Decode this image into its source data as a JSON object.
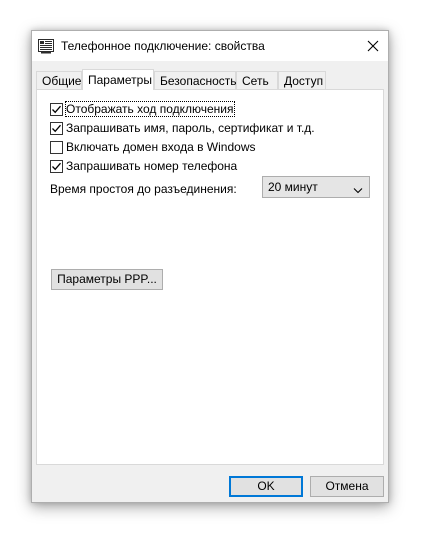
{
  "window": {
    "title": "Телефонное подключение: свойства"
  },
  "tabs": [
    {
      "label": "Общие",
      "active": false
    },
    {
      "label": "Параметры",
      "active": true
    },
    {
      "label": "Безопасность",
      "active": false
    },
    {
      "label": "Сеть",
      "active": false
    },
    {
      "label": "Доступ",
      "active": false
    }
  ],
  "options": {
    "show_progress": {
      "label": "Отображать ход подключения",
      "checked": true
    },
    "prompt_credentials": {
      "label": "Запрашивать имя, пароль, сертификат и т.д.",
      "checked": true
    },
    "include_domain": {
      "label": "Включать домен входа в Windows",
      "checked": false
    },
    "prompt_phone": {
      "label": "Запрашивать номер телефона",
      "checked": true
    }
  },
  "idle": {
    "label": "Время простоя до разъединения:",
    "value": "20 минут"
  },
  "buttons": {
    "ppp": "Параметры PPP...",
    "ok": "OK",
    "cancel": "Отмена"
  },
  "colors": {
    "accent": "#0078d7",
    "dialog_bg": "#f0f0f0",
    "panel_bg": "#ffffff"
  },
  "icons": {
    "app": "phone-connection-icon",
    "close": "close-icon",
    "dropdown": "chevron-down-icon",
    "check": "checkmark-icon"
  }
}
